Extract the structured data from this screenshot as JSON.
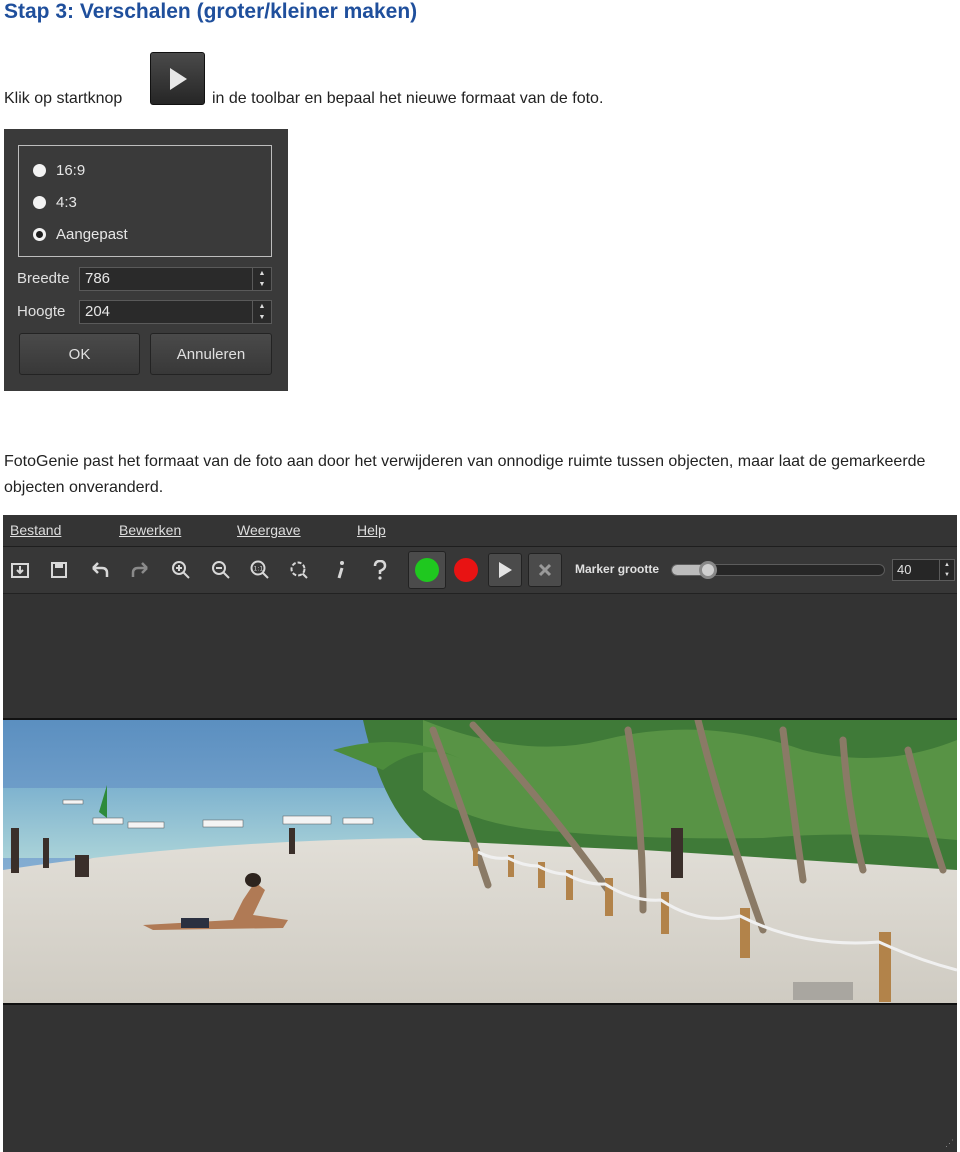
{
  "heading": "Stap 3: Verschalen (groter/kleiner maken)",
  "intro": {
    "before": "Klik op startknop",
    "after": "in de toolbar en bepaal het nieuwe formaat van de foto."
  },
  "dialog": {
    "ratios": [
      {
        "label": "16:9",
        "checked": false
      },
      {
        "label": "4:3",
        "checked": false
      },
      {
        "label": "Aangepast",
        "checked": true
      }
    ],
    "width_label": "Breedte",
    "width_value": "786",
    "height_label": "Hoogte",
    "height_value": "204",
    "ok_label": "OK",
    "cancel_label": "Annuleren"
  },
  "paragraph": "FotoGenie past het formaat van de foto aan door het verwijderen van onnodige ruimte tussen objecten, maar laat de gemarkeerde objecten onveranderd.",
  "app": {
    "menu": [
      "Bestand",
      "Bewerken",
      "Weergave",
      "Help"
    ],
    "toolbar_icons": [
      "open-icon",
      "save-icon",
      "undo-icon",
      "redo-icon",
      "zoom-in-icon",
      "zoom-out-icon",
      "actual-size-icon",
      "fit-icon",
      "info-icon",
      "help-icon",
      "green-marker-icon",
      "red-marker-icon",
      "play-icon",
      "clear-icon"
    ],
    "marker_label": "Marker grootte",
    "marker_value": "40",
    "marker_slider_fraction": 0.1,
    "colors": {
      "green_marker": "#1fc81f",
      "red_marker": "#e81313",
      "heading": "#1f4f9c"
    }
  }
}
